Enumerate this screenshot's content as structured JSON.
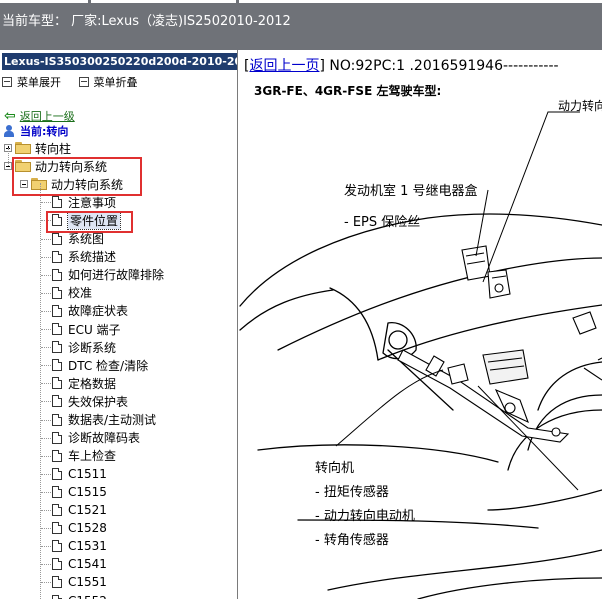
{
  "window": {
    "title": "当前车型： 厂家:Lexus（凌志)IS2502010-2012"
  },
  "left_panel": {
    "header": "Lexus-IS350300250220d200d-2010-2012",
    "toolbar": {
      "expand_label": "菜单展开",
      "collapse_label": "菜单折叠"
    },
    "back_label": "返回上一级",
    "current_label": "当前:转向",
    "tree": [
      {
        "label": "转向柱",
        "type": "folder",
        "expanded": false,
        "level": 0
      },
      {
        "label": "动力转向系统",
        "type": "folder",
        "expanded": true,
        "level": 0,
        "highlighted": true
      },
      {
        "label": "动力转向系统",
        "type": "folder",
        "expanded": true,
        "level": 1,
        "highlighted": true
      },
      {
        "label": "注意事项",
        "type": "doc",
        "level": 2
      },
      {
        "label": "零件位置",
        "type": "doc",
        "level": 2,
        "selected": true,
        "highlighted": true
      },
      {
        "label": "系统图",
        "type": "doc",
        "level": 2
      },
      {
        "label": "系统描述",
        "type": "doc",
        "level": 2
      },
      {
        "label": "如何进行故障排除",
        "type": "doc",
        "level": 2
      },
      {
        "label": "校准",
        "type": "doc",
        "level": 2
      },
      {
        "label": "故障症状表",
        "type": "doc",
        "level": 2
      },
      {
        "label": "ECU 端子",
        "type": "doc",
        "level": 2
      },
      {
        "label": "诊断系统",
        "type": "doc",
        "level": 2
      },
      {
        "label": "DTC 检查/清除",
        "type": "doc",
        "level": 2
      },
      {
        "label": "定格数据",
        "type": "doc",
        "level": 2
      },
      {
        "label": "失效保护表",
        "type": "doc",
        "level": 2
      },
      {
        "label": "数据表/主动测试",
        "type": "doc",
        "level": 2
      },
      {
        "label": "诊断故障码表",
        "type": "doc",
        "level": 2
      },
      {
        "label": "车上检查",
        "type": "doc",
        "level": 2
      },
      {
        "label": "C1511",
        "type": "doc",
        "level": 2
      },
      {
        "label": "C1515",
        "type": "doc",
        "level": 2
      },
      {
        "label": "C1521",
        "type": "doc",
        "level": 2
      },
      {
        "label": "C1528",
        "type": "doc",
        "level": 2
      },
      {
        "label": "C1531",
        "type": "doc",
        "level": 2
      },
      {
        "label": "C1541",
        "type": "doc",
        "level": 2
      },
      {
        "label": "C1551",
        "type": "doc",
        "level": 2
      },
      {
        "label": "C1552",
        "type": "doc",
        "level": 2
      }
    ]
  },
  "content": {
    "back_link": "返回上一页",
    "doc_no": "NO:92PC:1 .2016591946-----------",
    "model_heading": "3GR-FE、4GR-FSE 左驾驶车型:",
    "callouts": {
      "top_right": "动力转向",
      "relay_box": "发动机室 1 号继电器盒",
      "eps_fuse": "- EPS 保险丝",
      "steering_gear": "转向机",
      "torque_sensor": "- 扭矩传感器",
      "motor": "- 动力转向电动机",
      "angle_sensor": "- 转角传感器"
    }
  },
  "colors": {
    "title_bar": "#6f7278",
    "panel_header": "#1f3c6e",
    "highlight_box": "#e03030",
    "link": "#0000cc"
  }
}
